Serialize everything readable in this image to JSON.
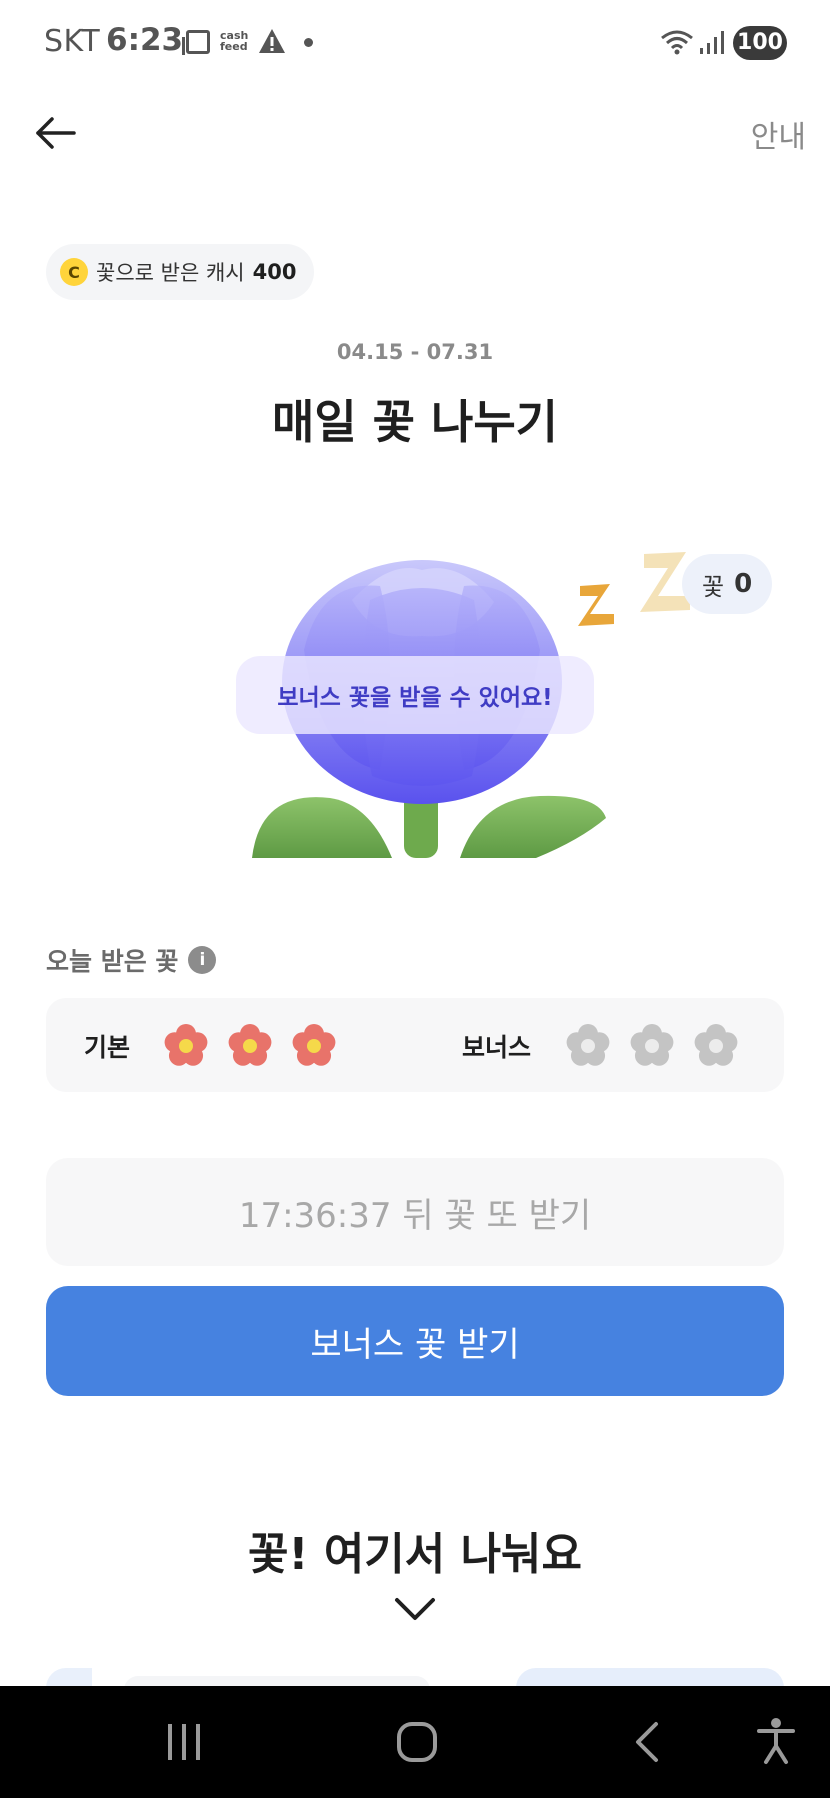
{
  "status_bar": {
    "carrier": "SKT",
    "time": "6:23",
    "cashfeed_logo": "cash feed",
    "battery": "100"
  },
  "header": {
    "info_label": "안내"
  },
  "cash_chip": {
    "coin_symbol": "C",
    "label": "꽃으로 받은 캐시",
    "value": "400"
  },
  "event": {
    "date_range": "04.15 - 07.31",
    "title": "매일 꽃 나누기"
  },
  "illustration": {
    "flower_count_label": "꽃",
    "flower_count_value": "0",
    "bubble_text": "보너스 꽃을 받을 수 있어요!"
  },
  "today": {
    "label": "오늘 받은 꽃",
    "info_symbol": "i",
    "basic_label": "기본",
    "basic_received": 3,
    "basic_total": 3,
    "bonus_label": "보너스",
    "bonus_received": 0,
    "bonus_total": 3
  },
  "timer_text": "17:36:37 뒤 꽃 또 받기",
  "bonus_button_label": "보너스 꽃 받기",
  "section_title": "꽃! 여기서 나눠요",
  "colors": {
    "accent_button": "#4682e0",
    "flower_received": "#e8736a",
    "flower_empty": "#c4c4c4",
    "bubble_text": "#3f3cc4"
  },
  "icons": [
    "back-arrow-icon",
    "coin-icon",
    "info-icon",
    "flower-icon",
    "zzz-icon",
    "chevron-down-icon",
    "recent-apps-icon",
    "home-icon",
    "nav-back-icon",
    "accessibility-icon"
  ]
}
